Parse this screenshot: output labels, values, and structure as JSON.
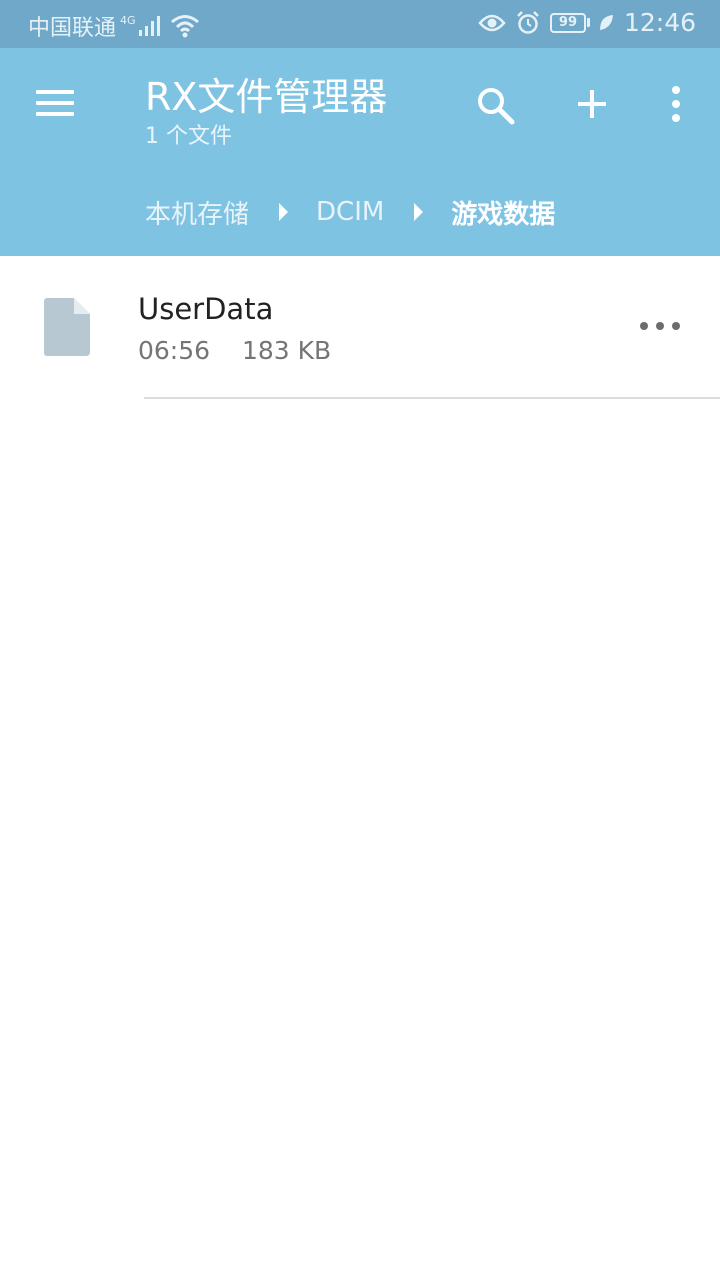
{
  "status_bar": {
    "carrier": "中国联通",
    "network": "4G",
    "battery": "99",
    "time": "12:46"
  },
  "app_bar": {
    "title": "RX文件管理器",
    "subtitle": "1 个文件",
    "icons": [
      "menu-icon",
      "search-icon",
      "add-icon",
      "more-vert-icon"
    ]
  },
  "breadcrumb": {
    "items": [
      "本机存储",
      "DCIM",
      "游戏数据"
    ]
  },
  "files": [
    {
      "name": "UserData",
      "time": "06:56",
      "size": "183 KB",
      "icon": "file-icon"
    }
  ],
  "colors": {
    "status_bar": "#6fa8c8",
    "app_bar": "#7fc3e3",
    "file_icon": "#b7c8d2"
  }
}
